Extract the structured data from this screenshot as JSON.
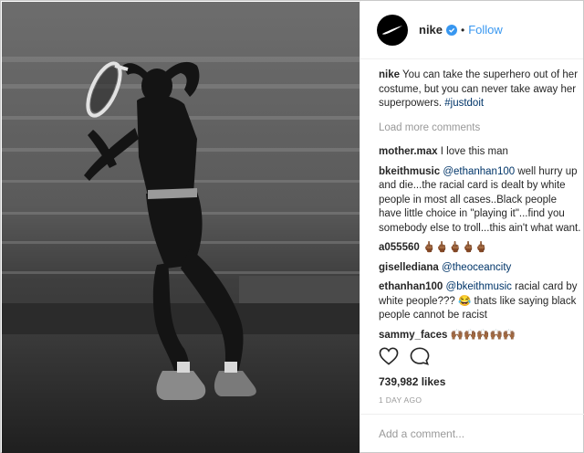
{
  "post": {
    "username": "nike",
    "follow_label": "Follow",
    "caption": {
      "username": "nike",
      "text": "You can take the superhero out of her costume, but you can never take away her superpowers.",
      "hashtag": "#justdoit"
    },
    "load_more_label": "Load more comments",
    "comments": [
      {
        "username": "mother.max",
        "text": "I love this man"
      },
      {
        "username": "bkeithmusic",
        "mention": "@ethanhan100",
        "text": "well hurry up and die...the racial card is dealt by white people in most all cases..Black people have little choice in \"playing it\"...find you somebody else to troll...this ain't what want."
      },
      {
        "username": "a055560",
        "text": "🖕🏾🖕🏾🖕🏾🖕🏾🖕🏾"
      },
      {
        "username": "gisellediana",
        "mention": "@theoceancity",
        "text": ""
      },
      {
        "username": "ethanhan100",
        "mention": "@bkeithmusic",
        "text": "racial card by white people??? 😂 thats like saying black people cannot be racist"
      },
      {
        "username": "sammy_faces",
        "text": "🙌🏾🙌🏾🙌🏾🙌🏾🙌🏾"
      }
    ],
    "likes": "739,982 likes",
    "timestamp": "1 DAY AGO",
    "add_comment_placeholder": "Add a comment...",
    "icons": {
      "like": "heart-icon",
      "comment": "comment-bubble-icon",
      "verified": "verified-badge-icon",
      "logo": "nike-swoosh-icon"
    },
    "colors": {
      "link_blue": "#3897f0",
      "mention": "#003569",
      "muted": "#999999",
      "text": "#262626"
    }
  }
}
